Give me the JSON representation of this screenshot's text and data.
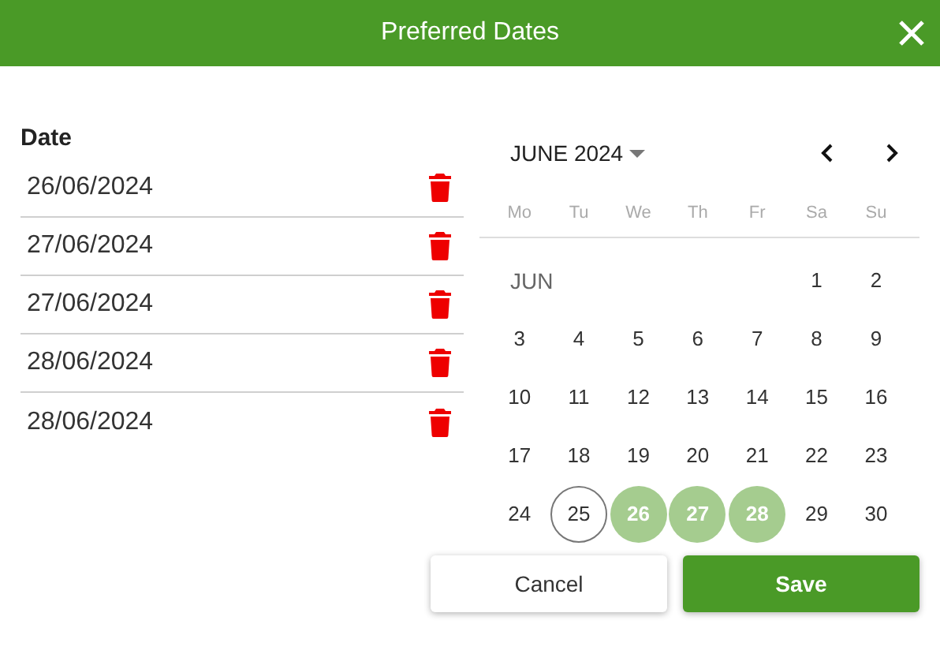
{
  "dialog": {
    "title": "Preferred Dates"
  },
  "dates": {
    "heading": "Date",
    "items": [
      "26/06/2024",
      "27/06/2024",
      "27/06/2024",
      "28/06/2024",
      "28/06/2024"
    ]
  },
  "calendar": {
    "month": "JUNE 2024",
    "weekdays": [
      "Mo",
      "Tu",
      "We",
      "Th",
      "Fr",
      "Sa",
      "Su"
    ],
    "month_label": "JUN",
    "days": [
      {
        "label": "1",
        "selected": false,
        "today": false
      },
      {
        "label": "2",
        "selected": false,
        "today": false
      },
      {
        "label": "3",
        "selected": false,
        "today": false
      },
      {
        "label": "4",
        "selected": false,
        "today": false
      },
      {
        "label": "5",
        "selected": false,
        "today": false
      },
      {
        "label": "6",
        "selected": false,
        "today": false
      },
      {
        "label": "7",
        "selected": false,
        "today": false
      },
      {
        "label": "8",
        "selected": false,
        "today": false
      },
      {
        "label": "9",
        "selected": false,
        "today": false
      },
      {
        "label": "10",
        "selected": false,
        "today": false
      },
      {
        "label": "11",
        "selected": false,
        "today": false
      },
      {
        "label": "12",
        "selected": false,
        "today": false
      },
      {
        "label": "13",
        "selected": false,
        "today": false
      },
      {
        "label": "14",
        "selected": false,
        "today": false
      },
      {
        "label": "15",
        "selected": false,
        "today": false
      },
      {
        "label": "16",
        "selected": false,
        "today": false
      },
      {
        "label": "17",
        "selected": false,
        "today": false
      },
      {
        "label": "18",
        "selected": false,
        "today": false
      },
      {
        "label": "19",
        "selected": false,
        "today": false
      },
      {
        "label": "20",
        "selected": false,
        "today": false
      },
      {
        "label": "21",
        "selected": false,
        "today": false
      },
      {
        "label": "22",
        "selected": false,
        "today": false
      },
      {
        "label": "23",
        "selected": false,
        "today": false
      },
      {
        "label": "24",
        "selected": false,
        "today": false
      },
      {
        "label": "25",
        "selected": false,
        "today": true
      },
      {
        "label": "26",
        "selected": true,
        "today": false
      },
      {
        "label": "27",
        "selected": true,
        "today": false
      },
      {
        "label": "28",
        "selected": true,
        "today": false
      },
      {
        "label": "29",
        "selected": false,
        "today": false
      },
      {
        "label": "30",
        "selected": false,
        "today": false
      }
    ]
  },
  "buttons": {
    "cancel": "Cancel",
    "save": "Save"
  }
}
